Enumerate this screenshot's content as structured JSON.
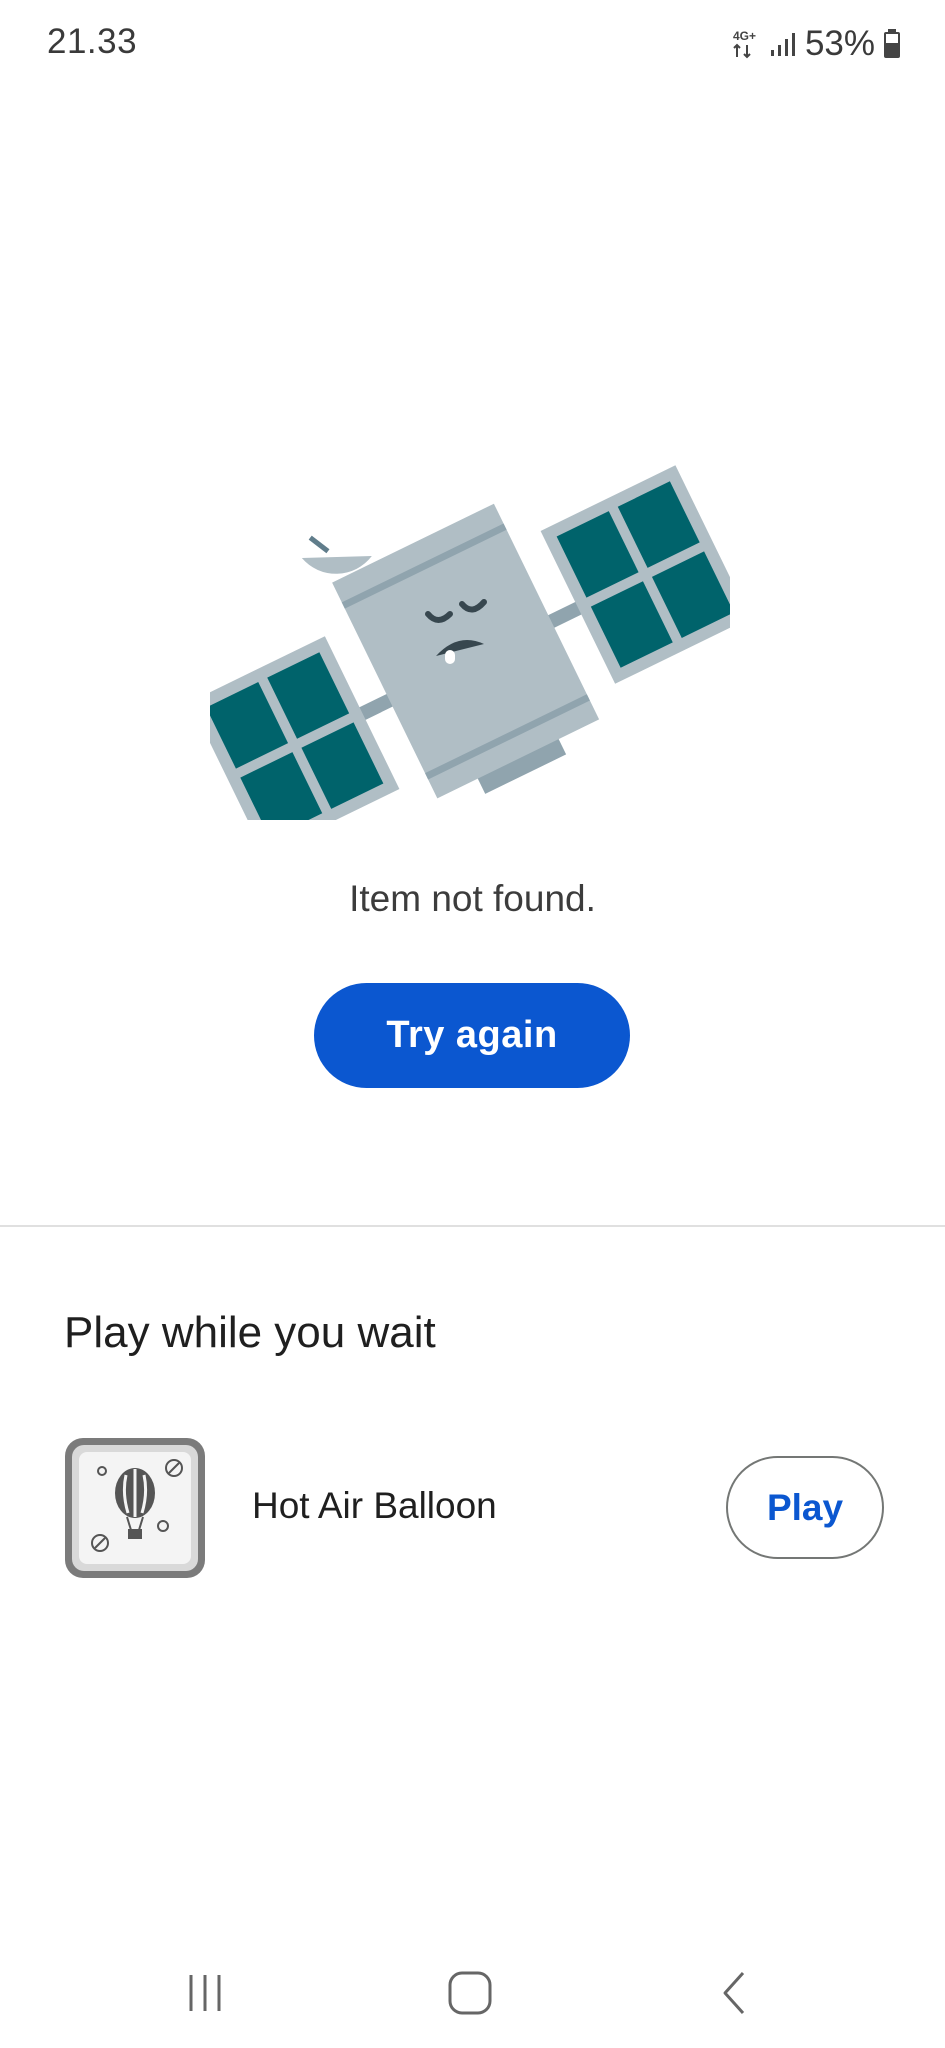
{
  "status_bar": {
    "time": "21.33",
    "network_label": "4G+",
    "battery": "53%",
    "icons": [
      "network-4g-icon",
      "signal-icon",
      "battery-icon"
    ]
  },
  "illustration": {
    "icon": "sleepy-satellite-illustration"
  },
  "error": {
    "message": "Item not found.",
    "retry_label": "Try again"
  },
  "play_section": {
    "title": "Play while you wait",
    "games": [
      {
        "name": "Hot Air Balloon",
        "icon": "hot-air-balloon-icon",
        "action_label": "Play"
      }
    ]
  },
  "navigation_bar": {
    "items": [
      "recents-icon",
      "home-icon",
      "back-icon"
    ]
  },
  "colors": {
    "primary": "#0b57d0",
    "panel": "#00636b",
    "satellite_body": "#b0bec5",
    "text": "#1f1f1f"
  }
}
